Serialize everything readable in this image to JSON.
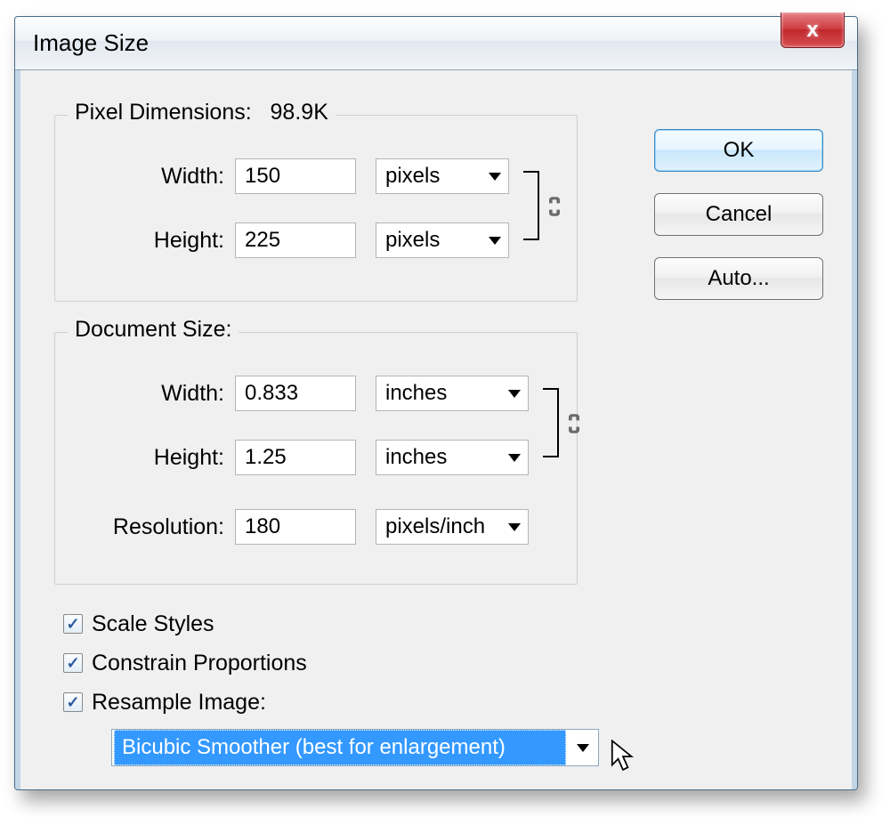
{
  "window": {
    "title": "Image Size",
    "close_glyph": "x"
  },
  "buttons": {
    "ok": "OK",
    "cancel": "Cancel",
    "auto": "Auto..."
  },
  "pixel_group": {
    "legend_prefix": "Pixel Dimensions:",
    "legend_value": "98.9K",
    "width_label": "Width:",
    "width_value": "150",
    "width_unit": "pixels",
    "height_label": "Height:",
    "height_value": "225",
    "height_unit": "pixels"
  },
  "doc_group": {
    "legend": "Document Size:",
    "width_label": "Width:",
    "width_value": "0.833",
    "width_unit": "inches",
    "height_label": "Height:",
    "height_value": "1.25",
    "height_unit": "inches",
    "res_label": "Resolution:",
    "res_value": "180",
    "res_unit": "pixels/inch"
  },
  "checks": {
    "scale_styles": "Scale Styles",
    "constrain": "Constrain Proportions",
    "resample": "Resample Image:"
  },
  "resample_method": "Bicubic Smoother (best for enlargement)"
}
